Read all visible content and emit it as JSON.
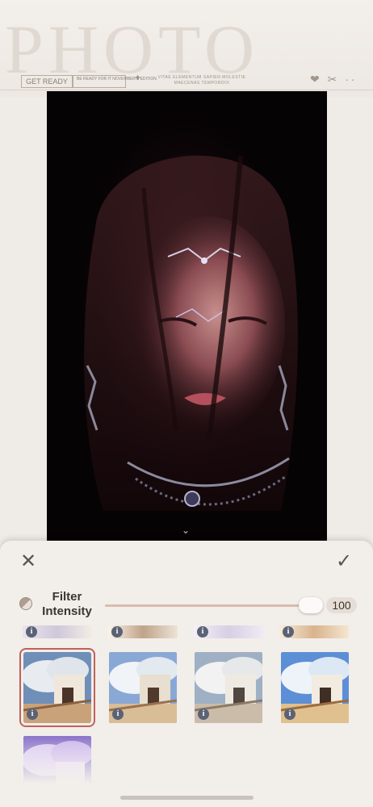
{
  "header": {
    "brand_text": "PHOTO",
    "badge_1": "GET READY",
    "badge_2": "BE READY FOR IT NOVEMBER'S EDITION",
    "sparkle": "✦",
    "tagline": "VITAE ELEMENTUM SAPIEN MOLESTIE MAECENAS TEMPORDOI",
    "icons": "❤ ✂ ··"
  },
  "photo": {
    "alt": "portrait"
  },
  "sheet": {
    "close_icon": "✕",
    "confirm_icon": "✓",
    "intensity_label": "Filter Intensity",
    "intensity_value": "100",
    "intensity_fraction": 1.0,
    "info_glyph": "i",
    "handle_glyph": "⌄"
  },
  "filters": [
    {
      "name": "filter-1",
      "selected": true
    },
    {
      "name": "filter-2",
      "selected": false
    },
    {
      "name": "filter-3",
      "selected": false
    },
    {
      "name": "filter-4",
      "selected": false
    },
    {
      "name": "filter-5",
      "selected": false
    }
  ],
  "colors": {
    "accent_selected": "#c0625a",
    "sheet_bg": "#f2eeea",
    "slider_track": "#e5cfc3",
    "info_badge": "#5b6275"
  }
}
